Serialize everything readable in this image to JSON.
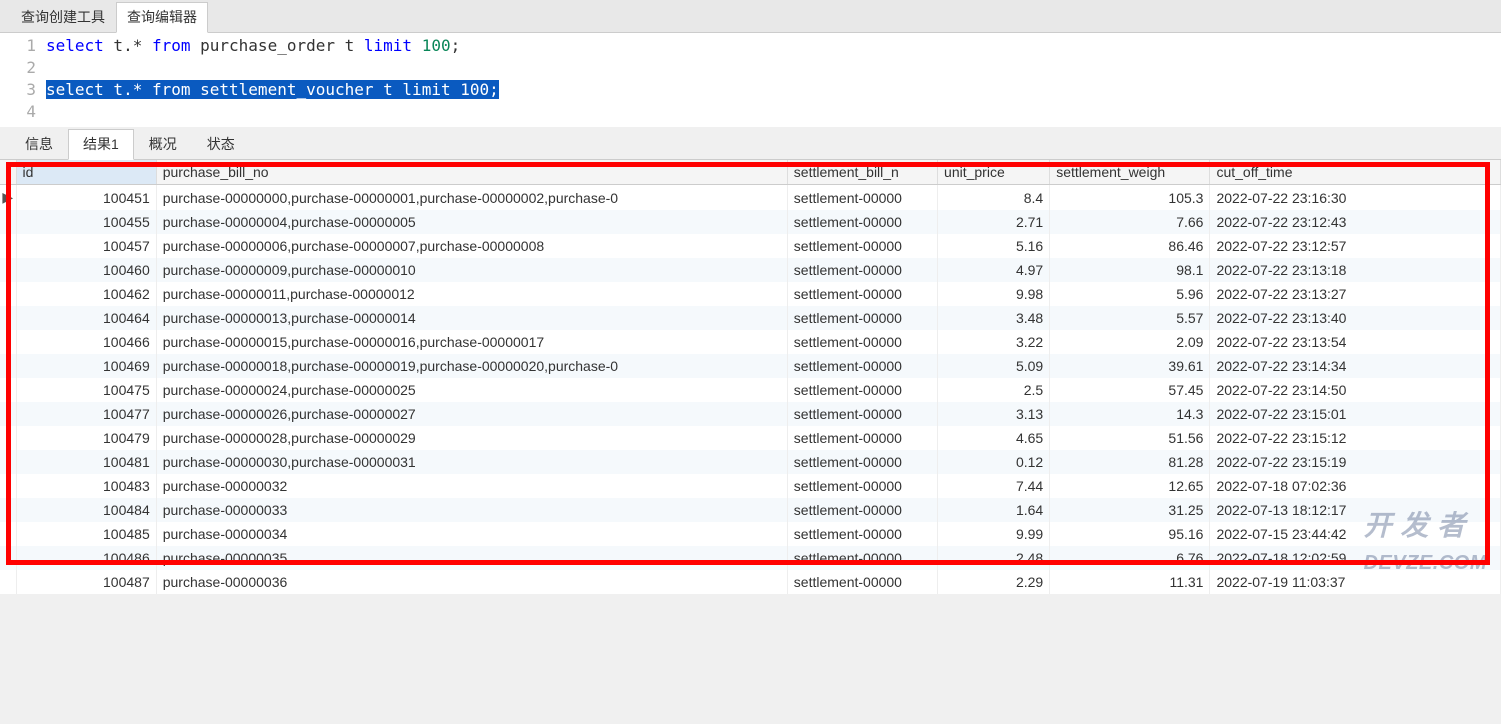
{
  "topTabs": {
    "builder": "查询创建工具",
    "editor": "查询编辑器"
  },
  "sql": {
    "line1": {
      "pre": "select",
      "mid1": " t.* ",
      "from": "from",
      "mid2": " purchase_order t ",
      "limit": "limit",
      "sp": " ",
      "num": "100",
      "semi": ";"
    },
    "line3": {
      "pre": "select",
      "mid1": " t.* ",
      "from": "from",
      "mid2": " settlement_voucher t ",
      "limit": "limit",
      "sp": " ",
      "num": "100",
      "semi": ";"
    }
  },
  "gutter": {
    "l1": "1",
    "l2": "2",
    "l3": "3",
    "l4": "4"
  },
  "resultTabs": {
    "info": "信息",
    "result1": "结果1",
    "profile": "概况",
    "status": "状态"
  },
  "columns": {
    "id": "id",
    "purchase_bill_no": "purchase_bill_no",
    "settlement_bill_no": "settlement_bill_n",
    "unit_price": "unit_price",
    "settlement_weight": "settlement_weigh",
    "cut_off_time": "cut_off_time"
  },
  "rows": [
    {
      "id": "100451",
      "pbn": "purchase-00000000,purchase-00000001,purchase-00000002,purchase-0",
      "sbn": "settlement-00000",
      "up": "8.4",
      "sw": "105.3",
      "cot": "2022-07-22 23:16:30",
      "ind": "▶"
    },
    {
      "id": "100455",
      "pbn": "purchase-00000004,purchase-00000005",
      "sbn": "settlement-00000",
      "up": "2.71",
      "sw": "7.66",
      "cot": "2022-07-22 23:12:43",
      "ind": ""
    },
    {
      "id": "100457",
      "pbn": "purchase-00000006,purchase-00000007,purchase-00000008",
      "sbn": "settlement-00000",
      "up": "5.16",
      "sw": "86.46",
      "cot": "2022-07-22 23:12:57",
      "ind": ""
    },
    {
      "id": "100460",
      "pbn": "purchase-00000009,purchase-00000010",
      "sbn": "settlement-00000",
      "up": "4.97",
      "sw": "98.1",
      "cot": "2022-07-22 23:13:18",
      "ind": ""
    },
    {
      "id": "100462",
      "pbn": "purchase-00000011,purchase-00000012",
      "sbn": "settlement-00000",
      "up": "9.98",
      "sw": "5.96",
      "cot": "2022-07-22 23:13:27",
      "ind": ""
    },
    {
      "id": "100464",
      "pbn": "purchase-00000013,purchase-00000014",
      "sbn": "settlement-00000",
      "up": "3.48",
      "sw": "5.57",
      "cot": "2022-07-22 23:13:40",
      "ind": ""
    },
    {
      "id": "100466",
      "pbn": "purchase-00000015,purchase-00000016,purchase-00000017",
      "sbn": "settlement-00000",
      "up": "3.22",
      "sw": "2.09",
      "cot": "2022-07-22 23:13:54",
      "ind": ""
    },
    {
      "id": "100469",
      "pbn": "purchase-00000018,purchase-00000019,purchase-00000020,purchase-0",
      "sbn": "settlement-00000",
      "up": "5.09",
      "sw": "39.61",
      "cot": "2022-07-22 23:14:34",
      "ind": ""
    },
    {
      "id": "100475",
      "pbn": "purchase-00000024,purchase-00000025",
      "sbn": "settlement-00000",
      "up": "2.5",
      "sw": "57.45",
      "cot": "2022-07-22 23:14:50",
      "ind": ""
    },
    {
      "id": "100477",
      "pbn": "purchase-00000026,purchase-00000027",
      "sbn": "settlement-00000",
      "up": "3.13",
      "sw": "14.3",
      "cot": "2022-07-22 23:15:01",
      "ind": ""
    },
    {
      "id": "100479",
      "pbn": "purchase-00000028,purchase-00000029",
      "sbn": "settlement-00000",
      "up": "4.65",
      "sw": "51.56",
      "cot": "2022-07-22 23:15:12",
      "ind": ""
    },
    {
      "id": "100481",
      "pbn": "purchase-00000030,purchase-00000031",
      "sbn": "settlement-00000",
      "up": "0.12",
      "sw": "81.28",
      "cot": "2022-07-22 23:15:19",
      "ind": ""
    },
    {
      "id": "100483",
      "pbn": "purchase-00000032",
      "sbn": "settlement-00000",
      "up": "7.44",
      "sw": "12.65",
      "cot": "2022-07-18 07:02:36",
      "ind": ""
    },
    {
      "id": "100484",
      "pbn": "purchase-00000033",
      "sbn": "settlement-00000",
      "up": "1.64",
      "sw": "31.25",
      "cot": "2022-07-13 18:12:17",
      "ind": ""
    },
    {
      "id": "100485",
      "pbn": "purchase-00000034",
      "sbn": "settlement-00000",
      "up": "9.99",
      "sw": "95.16",
      "cot": "2022-07-15 23:44:42",
      "ind": ""
    },
    {
      "id": "100486",
      "pbn": "purchase-00000035",
      "sbn": "settlement-00000",
      "up": "2.48",
      "sw": "6.76",
      "cot": "2022-07-18 12:02:59",
      "ind": ""
    },
    {
      "id": "100487",
      "pbn": "purchase-00000036",
      "sbn": "settlement-00000",
      "up": "2.29",
      "sw": "11.31",
      "cot": "2022-07-19 11:03:37",
      "ind": ""
    }
  ],
  "watermark": "开发者\nDEVZE.COM"
}
